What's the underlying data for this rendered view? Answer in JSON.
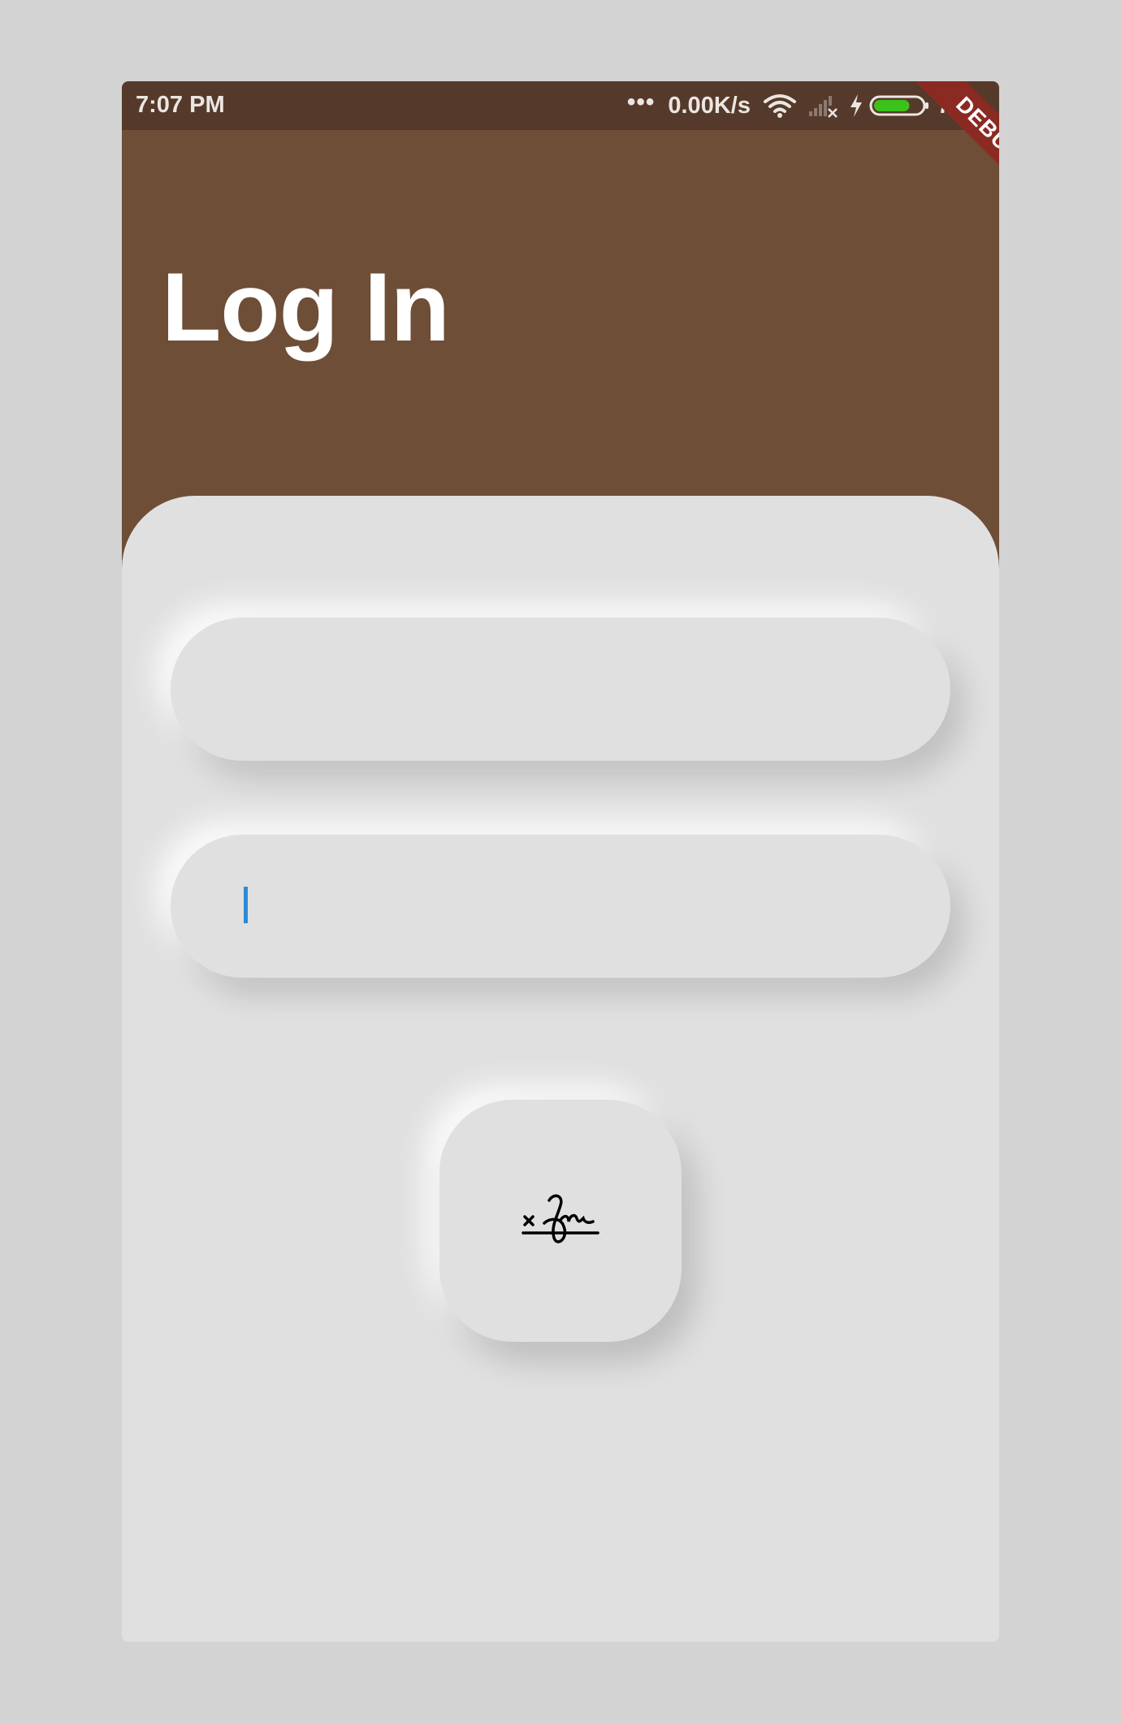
{
  "status_bar": {
    "time": "7:07 PM",
    "dots": "•••",
    "net_speed": "0.00K/s",
    "battery_percent": "75%",
    "battery_level": 0.75,
    "battery_color": "#3cc21b"
  },
  "app_bar": {
    "title": "Log In",
    "debug_label": "DEBUG",
    "color": "#6e4e37"
  },
  "form": {
    "username": {
      "value": "",
      "placeholder": ""
    },
    "password": {
      "value": "",
      "placeholder": "",
      "focused": true
    },
    "submit_icon": "signature-icon"
  },
  "colors": {
    "background": "#e0e0e0",
    "caret": "#2a8bd8"
  }
}
